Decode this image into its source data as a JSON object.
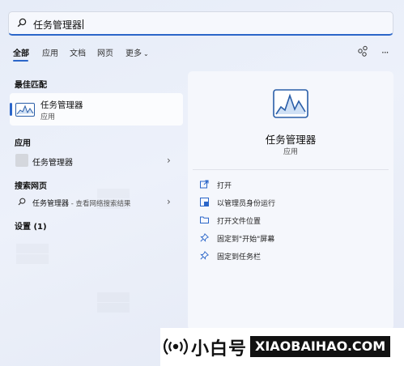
{
  "search": {
    "query": "任务管理器"
  },
  "tabs": [
    "全部",
    "应用",
    "文档",
    "网页",
    "更多"
  ],
  "active_tab": "全部",
  "sections": {
    "best_match": "最佳匹配",
    "apps": "应用",
    "web": "搜索网页",
    "settings": "设置 (1)"
  },
  "best_match": {
    "name": "任务管理器",
    "type": "应用"
  },
  "app_result": {
    "name": "任务管理器"
  },
  "web_result": {
    "query": "任务管理器",
    "hint": " - 查看网络搜索结果"
  },
  "detail": {
    "title": "任务管理器",
    "type": "应用",
    "actions": [
      "打开",
      "以管理员身份运行",
      "打开文件位置",
      "固定到\"开始\"屏幕",
      "固定到任务栏"
    ]
  },
  "banner": {
    "brand_cn": "小白号",
    "brand_en": "XIAOBAIHAO.COM"
  },
  "colors": {
    "accent": "#2b66c9"
  },
  "icons": [
    "search-icon",
    "share-icon",
    "more-icon",
    "task-manager-icon",
    "chevron-right-icon",
    "open-icon",
    "admin-icon",
    "folder-icon",
    "pin-icon",
    "radio-icon"
  ]
}
